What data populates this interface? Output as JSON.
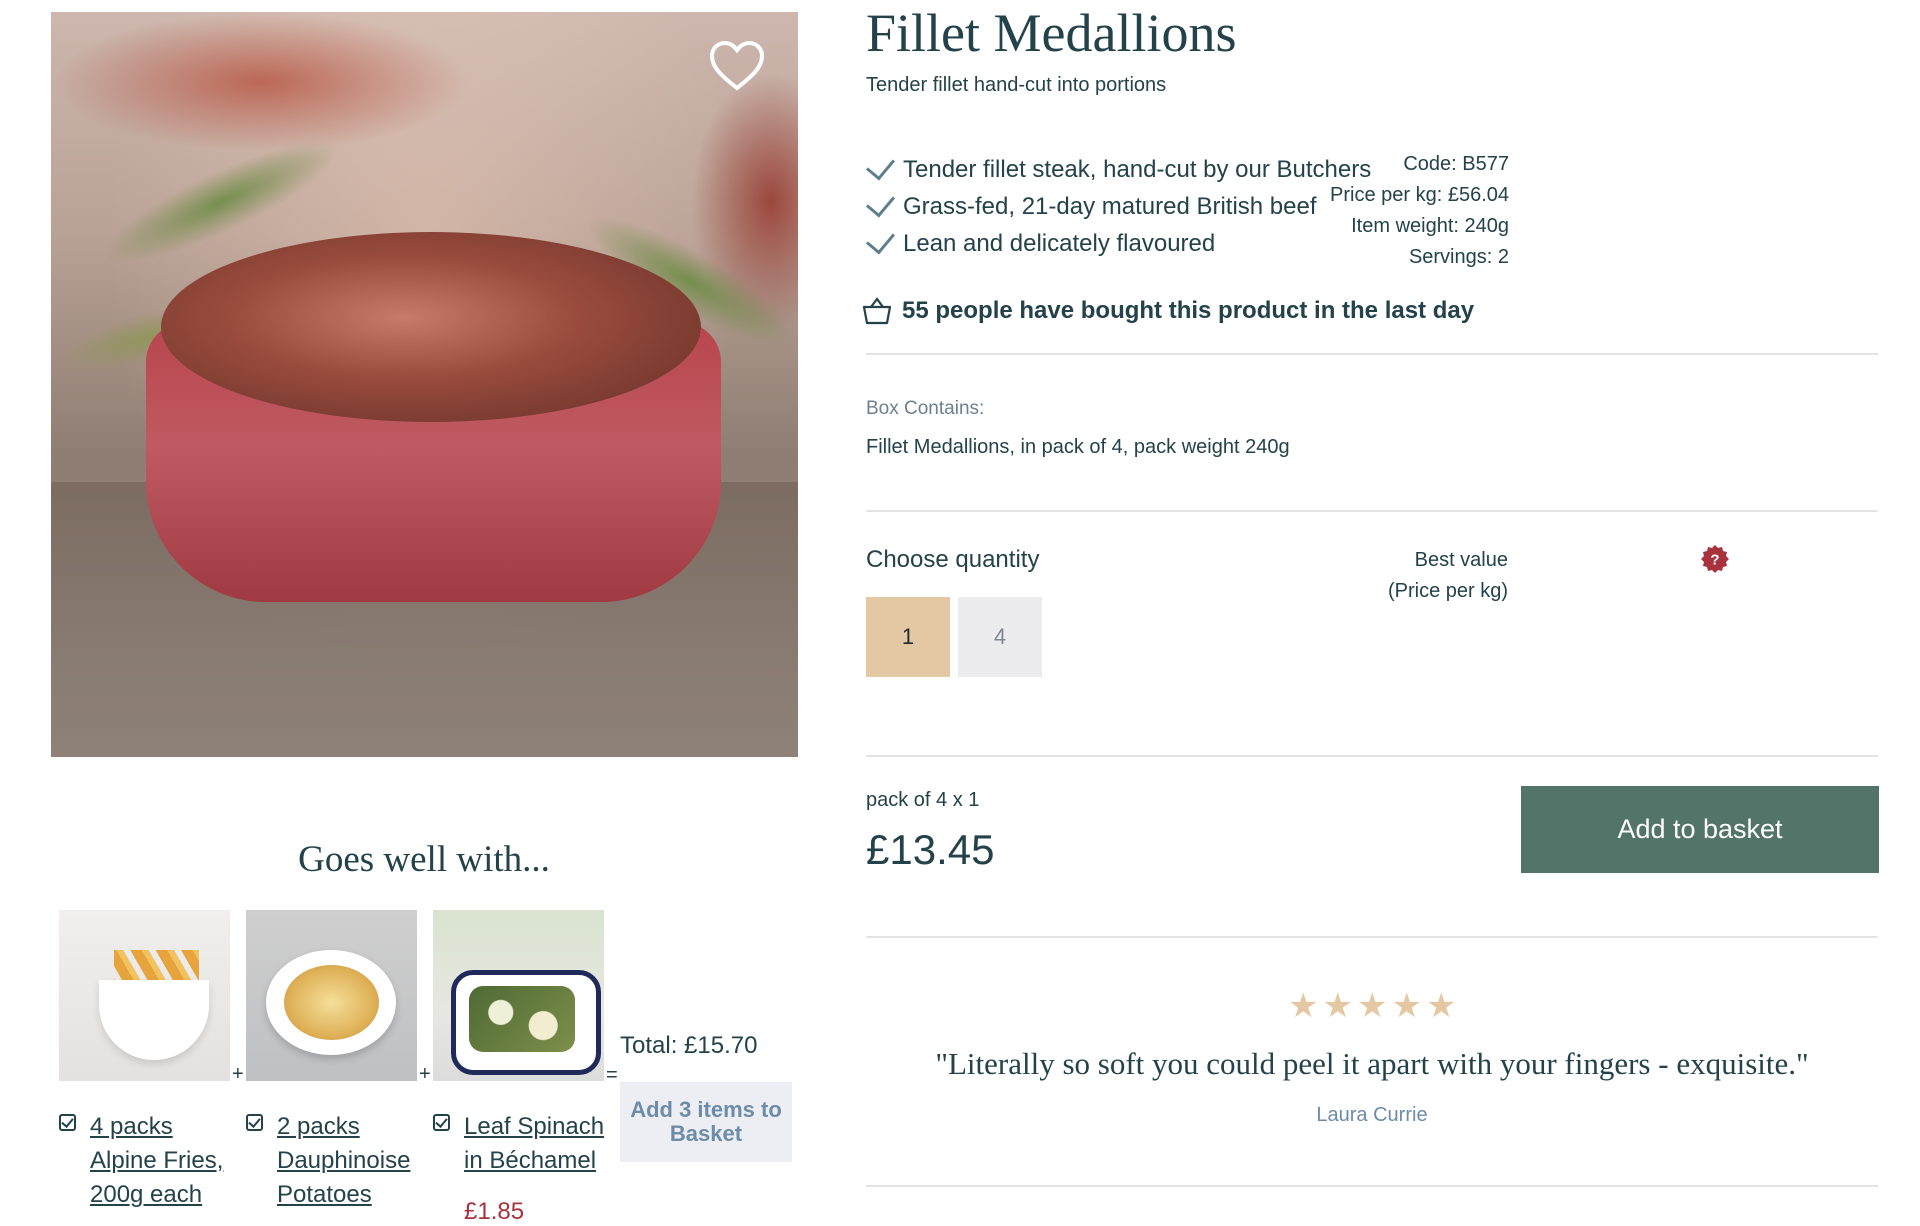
{
  "product": {
    "title": "Fillet Medallions",
    "subtitle": "Tender fillet hand-cut into portions",
    "features": [
      "Tender fillet steak, hand-cut by our Butchers",
      "Grass-fed, 21-day matured British beef",
      "Lean and delicately flavoured"
    ],
    "specs": {
      "code": "Code: B577",
      "price_per_kg": "Price per kg: £56.04",
      "item_weight": "Item weight: 240g",
      "servings": "Servings: 2"
    },
    "social_proof": "55 people have bought this product in the last day",
    "box_contains_label": "Box Contains:",
    "box_contains": "Fillet Medallions, in pack of 4, pack weight 240g",
    "image_icon": "heart-icon"
  },
  "quantity": {
    "label": "Choose quantity",
    "options": [
      "1",
      "4"
    ],
    "selected": "1",
    "best_value_icon": "question-badge-icon",
    "best_value_line1": "Best value",
    "best_value_line2": "(Price per kg)"
  },
  "purchase": {
    "pack_line": "pack of 4  x 1",
    "price": "£13.45",
    "add_to_basket": "Add to basket"
  },
  "goes_well_with": {
    "title": "Goes well with...",
    "items": [
      {
        "name": "4 packs Alpine Fries, 200g each",
        "image": "fries-photo",
        "checked": true
      },
      {
        "name": "2 packs Dauphinoise Potatoes",
        "image": "dauphinoise-photo",
        "checked": true
      },
      {
        "name": "Leaf Spinach in Béchamel",
        "image": "spinach-photo",
        "checked": true,
        "price": "£1.85"
      }
    ],
    "plus": "+",
    "equals": "=",
    "total": "Total: £15.70",
    "add_button": "Add 3 items to Basket"
  },
  "review": {
    "rating": 5,
    "star": "★",
    "quote": "\"Literally so soft you could peel it apart with your fingers - exquisite.\"",
    "author": "Laura Currie"
  },
  "colors": {
    "text": "#24424a",
    "accent_green": "#537468",
    "quantity_selected": "#e4c8a3",
    "price_red": "#a8323e",
    "badge_red": "#a8323e"
  }
}
